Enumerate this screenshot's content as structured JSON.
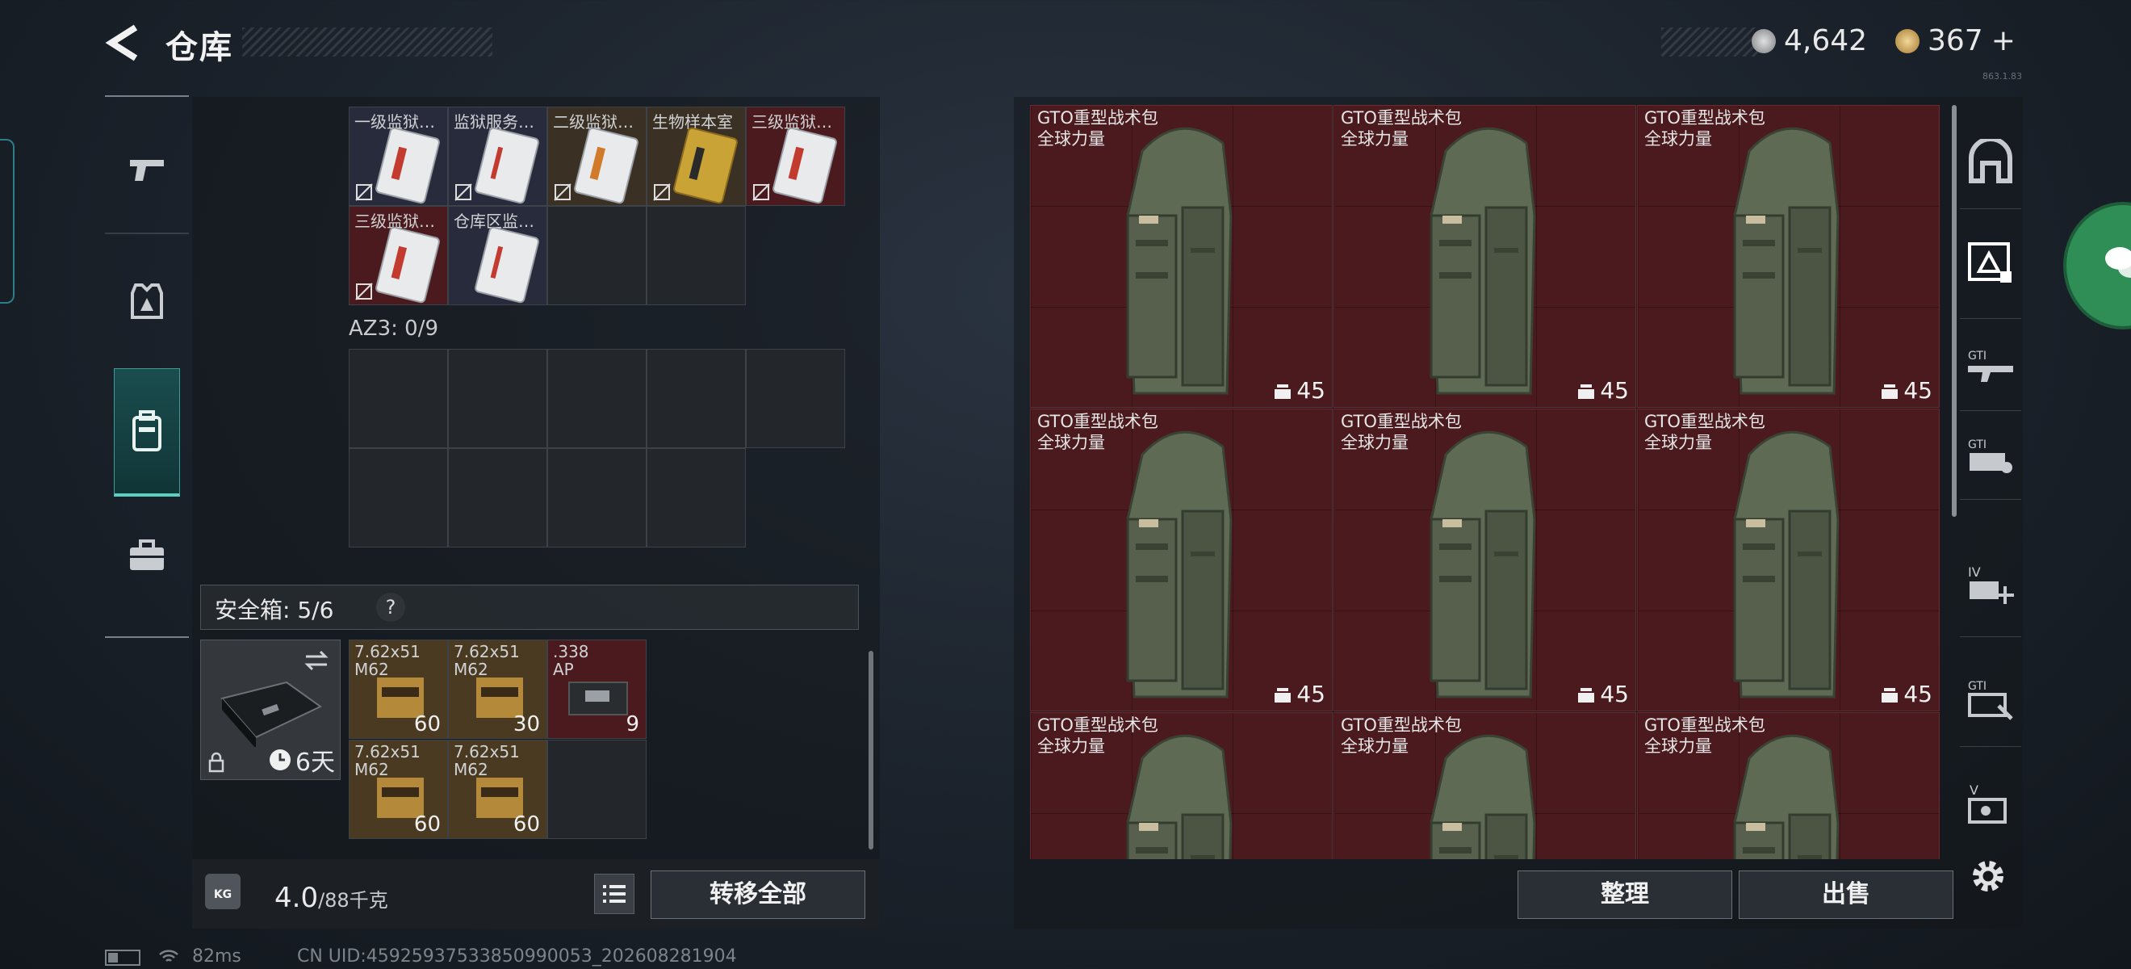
{
  "header": {
    "title": "仓库"
  },
  "currency": {
    "coins": "4,642",
    "tokens": "367",
    "tokens_suffix": "+",
    "version": "863.1.83"
  },
  "left_nav": [
    "pistol-icon",
    "armor-icon",
    "backpack-icon",
    "briefcase-icon"
  ],
  "keycards": [
    {
      "label": "一级监狱…",
      "bg": "navy",
      "stripe": "#c23b2e"
    },
    {
      "label": "监狱服务…",
      "bg": "navy",
      "stripe": "#c23b2e"
    },
    {
      "label": "二级监狱…",
      "bg": "brown",
      "stripe": "#d07a2a"
    },
    {
      "label": "生物样本室",
      "bg": "brown",
      "stripe": "#c9a336"
    },
    {
      "label": "三级监狱…",
      "bg": "red",
      "stripe": "#c23b2e"
    },
    {
      "label": "三级监狱…",
      "bg": "red",
      "stripe": "#c23b2e"
    },
    {
      "label": "仓库区监…",
      "bg": "navy",
      "stripe": "#c23b2e"
    }
  ],
  "az3": "AZ3: 0/9",
  "safe_box": {
    "label": "安全箱: 5/6",
    "help": "?",
    "timer": "6天",
    "ammo": [
      {
        "l1": "7.62x51",
        "l2": "M62",
        "qty": "60"
      },
      {
        "l1": "7.62x51",
        "l2": "M62",
        "qty": "30"
      },
      {
        "l1": ".338",
        "l2": "AP",
        "qty": "9"
      },
      {
        "l1": "7.62x51",
        "l2": "M62",
        "qty": "60"
      },
      {
        "l1": "7.62x51",
        "l2": "M62",
        "qty": "60"
      }
    ]
  },
  "weight": {
    "value": "4.0",
    "max": "/88千克",
    "kg_icon": "KG"
  },
  "buttons": {
    "transfer_all": "转移全部",
    "organize": "整理",
    "sell": "出售"
  },
  "bag_items": [
    {
      "name": "GTO重型战术包",
      "sub": "全球力量",
      "qty": "45"
    },
    {
      "name": "GTO重型战术包",
      "sub": "全球力量",
      "qty": "45"
    },
    {
      "name": "GTO重型战术包",
      "sub": "全球力量",
      "qty": "45"
    },
    {
      "name": "GTO重型战术包",
      "sub": "全球力量",
      "qty": "45"
    },
    {
      "name": "GTO重型战术包",
      "sub": "全球力量",
      "qty": "45"
    },
    {
      "name": "GTO重型战术包",
      "sub": "全球力量",
      "qty": "45"
    },
    {
      "name": "GTO重型战术包",
      "sub": "全球力量",
      "qty": ""
    },
    {
      "name": "GTO重型战术包",
      "sub": "全球力量",
      "qty": ""
    },
    {
      "name": "GTO重型战术包",
      "sub": "全球力量",
      "qty": ""
    }
  ],
  "right_sidebar": [
    "vault-icon",
    "gti-filter-icon",
    "gti-rifle-icon",
    "gti-case-icon",
    "iv-plus-icon",
    "gti-map-icon",
    "v-box-icon"
  ],
  "status": {
    "ping": "82ms",
    "uid": "CN UID:459259375338509900​53_202608281904"
  }
}
